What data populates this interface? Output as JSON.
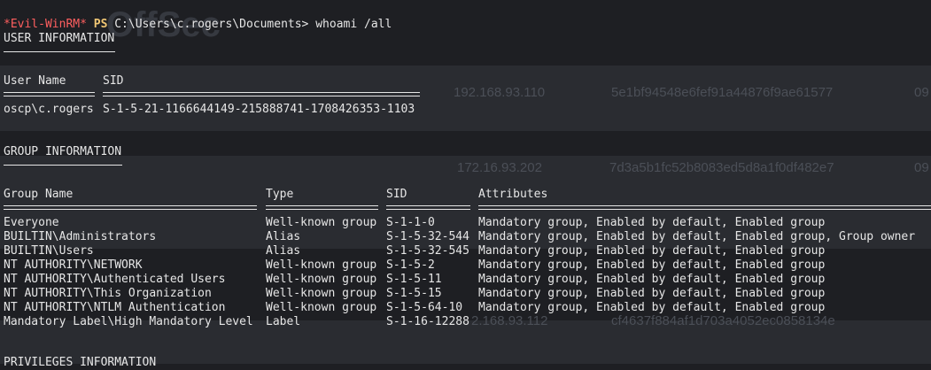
{
  "prompt": {
    "tag": "*Evil-WinRM*",
    "ps": "PS",
    "path": "C:\\Users\\c.rogers\\Documents>",
    "command": "whoami /all"
  },
  "background_watermark": {
    "title": "OffSec",
    "rows": [
      {
        "ip": "192.168.93.110",
        "hash": "5e1bf94548e6fef91a44876f9ae61577",
        "tail": "09"
      },
      {
        "ip": "172.16.93.202",
        "hash": "7d3a5b1fc52b8083ed5d8a1f0df482e7",
        "tail": "09"
      },
      {
        "ip": "2.168.93.112",
        "hash": "cf4637f884af1d703a4052ec0858134e",
        "tail": ""
      }
    ]
  },
  "user_section": {
    "heading": "USER INFORMATION",
    "col_user": "User Name",
    "col_sid": "SID",
    "user": "oscp\\c.rogers",
    "sid": "S-1-5-21-1166644149-215888741-1708426353-1103"
  },
  "group_section": {
    "heading": "GROUP INFORMATION",
    "columns": [
      "Group Name",
      "Type",
      "SID",
      "Attributes"
    ],
    "rows": [
      {
        "name": "Everyone",
        "type": "Well-known group",
        "sid": "S-1-1-0",
        "attrs": "Mandatory group, Enabled by default, Enabled group"
      },
      {
        "name": "BUILTIN\\Administrators",
        "type": "Alias",
        "sid": "S-1-5-32-544",
        "attrs": "Mandatory group, Enabled by default, Enabled group, Group owner"
      },
      {
        "name": "BUILTIN\\Users",
        "type": "Alias",
        "sid": "S-1-5-32-545",
        "attrs": "Mandatory group, Enabled by default, Enabled group"
      },
      {
        "name": "NT AUTHORITY\\NETWORK",
        "type": "Well-known group",
        "sid": "S-1-5-2",
        "attrs": "Mandatory group, Enabled by default, Enabled group"
      },
      {
        "name": "NT AUTHORITY\\Authenticated Users",
        "type": "Well-known group",
        "sid": "S-1-5-11",
        "attrs": "Mandatory group, Enabled by default, Enabled group"
      },
      {
        "name": "NT AUTHORITY\\This Organization",
        "type": "Well-known group",
        "sid": "S-1-5-15",
        "attrs": "Mandatory group, Enabled by default, Enabled group"
      },
      {
        "name": "NT AUTHORITY\\NTLM Authentication",
        "type": "Well-known group",
        "sid": "S-1-5-64-10",
        "attrs": "Mandatory group, Enabled by default, Enabled group"
      },
      {
        "name": "Mandatory Label\\High Mandatory Level",
        "type": "Label",
        "sid": "S-1-16-12288",
        "attrs": ""
      }
    ]
  },
  "privileges_section": {
    "heading": "PRIVILEGES INFORMATION"
  }
}
